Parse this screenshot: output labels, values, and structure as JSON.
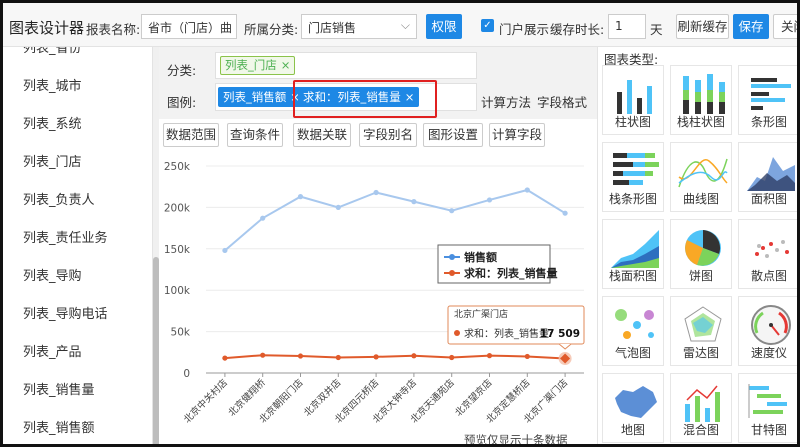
{
  "toolbar": {
    "title": "图表设计器",
    "report_name_label": "报表名称:",
    "report_name_value": "省市（门店）曲",
    "category_label": "所属分类:",
    "category_value": "门店销售",
    "permission_button": "权限",
    "portal_display_label": "门户展示",
    "portal_display_checked": true,
    "cache_label": "缓存时长:",
    "cache_value": "1",
    "cache_unit": "天",
    "refresh_cache_button": "刷新缓存",
    "save_button": "保存",
    "close_button": "关闭"
  },
  "sidebar": {
    "items": [
      "列表_省份",
      "列表_城市",
      "列表_系统",
      "列表_门店",
      "列表_负责人",
      "列表_责任业务",
      "列表_导购",
      "列表_导购电话",
      "列表_产品",
      "列表_销售量",
      "列表_销售额"
    ]
  },
  "config": {
    "category_label": "分类:",
    "category_tag": "列表_门店",
    "legend_label": "图例:",
    "legend_tags": [
      "列表_销售额",
      "求和：列表_销售量"
    ],
    "calc_method": "计算方法",
    "field_format": "字段格式",
    "tag_close": "×"
  },
  "tabs": [
    "数据范围",
    "查询条件",
    "数据关联",
    "字段别名",
    "图形设置",
    "计算字段"
  ],
  "chart_data": {
    "type": "line",
    "categories": [
      "北京中关村店",
      "北京健翔桥",
      "北京朝阳门店",
      "北京双井店",
      "北京四元桥店",
      "北京大钟寺店",
      "北京天通苑店",
      "北京望京店",
      "北京定慧桥店",
      "北京广渠门店"
    ],
    "series": [
      {
        "name": "销售额",
        "color": "#a8c8ee",
        "values": [
          148000,
          187000,
          213000,
          200000,
          218000,
          207000,
          196000,
          209000,
          221000,
          193000
        ]
      },
      {
        "name": "求和：列表_销售量",
        "color": "#e05a2b",
        "values": [
          18000,
          21500,
          20500,
          18700,
          19500,
          20800,
          18700,
          21000,
          20000,
          17509
        ]
      }
    ],
    "y_ticks": [
      "0",
      "50k",
      "100k",
      "150k",
      "200k",
      "250k"
    ],
    "ylim": [
      0,
      250000
    ],
    "legend": "center-right",
    "tooltip": {
      "title": "北京广渠门店",
      "label": "求和：列表_销售量:",
      "value": "17 509"
    },
    "footer": "预览仅显示十条数据"
  },
  "chart_types": {
    "title": "图表类型:",
    "tiles": [
      {
        "label": "柱状图",
        "icon": "bar-chart-icon"
      },
      {
        "label": "栈柱状图",
        "icon": "stacked-bar-icon"
      },
      {
        "label": "条形图",
        "icon": "horizontal-bar-icon"
      },
      {
        "label": "栈条形图",
        "icon": "stacked-hbar-icon"
      },
      {
        "label": "曲线图",
        "icon": "curve-chart-icon"
      },
      {
        "label": "面积图",
        "icon": "area-chart-icon"
      },
      {
        "label": "栈面积图",
        "icon": "stacked-area-icon"
      },
      {
        "label": "饼图",
        "icon": "pie-chart-icon"
      },
      {
        "label": "散点图",
        "icon": "scatter-chart-icon"
      },
      {
        "label": "气泡图",
        "icon": "bubble-chart-icon"
      },
      {
        "label": "雷达图",
        "icon": "radar-chart-icon"
      },
      {
        "label": "速度仪",
        "icon": "gauge-icon"
      },
      {
        "label": "地图",
        "icon": "map-icon"
      },
      {
        "label": "混合图",
        "icon": "mixed-chart-icon"
      },
      {
        "label": "甘特图",
        "icon": "gantt-chart-icon"
      }
    ]
  }
}
